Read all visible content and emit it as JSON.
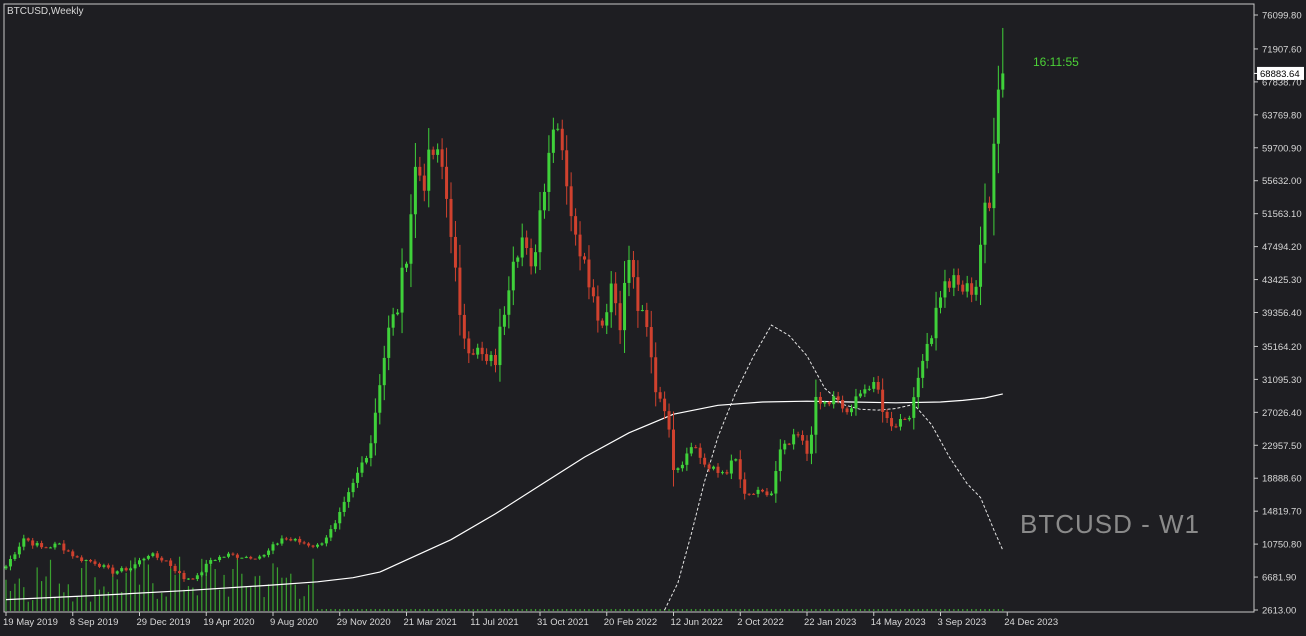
{
  "chart_data": {
    "type": "candlestick",
    "title": "BTCUSD,Weekly",
    "watermark": "BTCUSD - W1",
    "timer": "16:11:55",
    "current_price_label": "68883.64",
    "y_ticks": [
      "76099.80",
      "71907.60",
      "67838.70",
      "63769.80",
      "59700.90",
      "55632.00",
      "51563.10",
      "47494.20",
      "43425.30",
      "39356.40",
      "35164.20",
      "31095.30",
      "27026.40",
      "22957.50",
      "18888.60",
      "14819.70",
      "10750.80",
      "6681.90",
      "2613.00"
    ],
    "ylim": [
      2613.0,
      76099.8
    ],
    "x_ticks": [
      "19 May 2019",
      "8 Sep 2019",
      "29 Dec 2019",
      "19 Apr 2020",
      "9 Aug 2020",
      "29 Nov 2020",
      "21 Mar 2021",
      "11 Jul 2021",
      "31 Oct 2021",
      "20 Feb 2022",
      "12 Jun 2022",
      "2 Oct 2022",
      "22 Jan 2023",
      "14 May 2023",
      "3 Sep 2023",
      "24 Dec 2023"
    ],
    "anchors": [
      {
        "i": 0,
        "c": 8000
      },
      {
        "i": 4,
        "c": 11500
      },
      {
        "i": 8,
        "c": 10300
      },
      {
        "i": 12,
        "c": 10700
      },
      {
        "i": 16,
        "c": 9000
      },
      {
        "i": 20,
        "c": 8500
      },
      {
        "i": 24,
        "c": 7300
      },
      {
        "i": 28,
        "c": 7800
      },
      {
        "i": 32,
        "c": 9500
      },
      {
        "i": 36,
        "c": 8700
      },
      {
        "i": 40,
        "c": 6500
      },
      {
        "i": 43,
        "c": 6700
      },
      {
        "i": 46,
        "c": 8800
      },
      {
        "i": 50,
        "c": 9400
      },
      {
        "i": 54,
        "c": 9200
      },
      {
        "i": 58,
        "c": 9300
      },
      {
        "i": 62,
        "c": 11500
      },
      {
        "i": 66,
        "c": 11000
      },
      {
        "i": 70,
        "c": 10500
      },
      {
        "i": 74,
        "c": 13000
      },
      {
        "i": 78,
        "c": 18000
      },
      {
        "i": 82,
        "c": 23500
      },
      {
        "i": 84,
        "c": 31000
      },
      {
        "i": 86,
        "c": 37000
      },
      {
        "i": 88,
        "c": 40000
      },
      {
        "i": 90,
        "c": 47000
      },
      {
        "i": 92,
        "c": 57000
      },
      {
        "i": 94,
        "c": 56000
      },
      {
        "i": 96,
        "c": 59000
      },
      {
        "i": 98,
        "c": 57000
      },
      {
        "i": 100,
        "c": 50000
      },
      {
        "i": 102,
        "c": 38000
      },
      {
        "i": 104,
        "c": 35500
      },
      {
        "i": 106,
        "c": 34500
      },
      {
        "i": 108,
        "c": 33000
      },
      {
        "i": 110,
        "c": 33500
      },
      {
        "i": 112,
        "c": 40000
      },
      {
        "i": 114,
        "c": 47000
      },
      {
        "i": 116,
        "c": 48500
      },
      {
        "i": 118,
        "c": 44000
      },
      {
        "i": 120,
        "c": 52000
      },
      {
        "i": 122,
        "c": 60000
      },
      {
        "i": 124,
        "c": 64000
      },
      {
        "i": 126,
        "c": 56000
      },
      {
        "i": 128,
        "c": 48000
      },
      {
        "i": 130,
        "c": 47000
      },
      {
        "i": 132,
        "c": 41000
      },
      {
        "i": 134,
        "c": 38000
      },
      {
        "i": 136,
        "c": 43000
      },
      {
        "i": 138,
        "c": 38500
      },
      {
        "i": 140,
        "c": 46000
      },
      {
        "i": 142,
        "c": 40000
      },
      {
        "i": 144,
        "c": 37000
      },
      {
        "i": 146,
        "c": 30000
      },
      {
        "i": 148,
        "c": 28000
      },
      {
        "i": 150,
        "c": 20500
      },
      {
        "i": 152,
        "c": 21000
      },
      {
        "i": 154,
        "c": 23500
      },
      {
        "i": 156,
        "c": 21500
      },
      {
        "i": 158,
        "c": 20000
      },
      {
        "i": 160,
        "c": 19500
      },
      {
        "i": 162,
        "c": 20000
      },
      {
        "i": 164,
        "c": 21000
      },
      {
        "i": 166,
        "c": 16500
      },
      {
        "i": 168,
        "c": 17000
      },
      {
        "i": 170,
        "c": 16800
      },
      {
        "i": 172,
        "c": 17000
      },
      {
        "i": 174,
        "c": 22000
      },
      {
        "i": 176,
        "c": 23000
      },
      {
        "i": 178,
        "c": 24000
      },
      {
        "i": 180,
        "c": 22000
      },
      {
        "i": 182,
        "c": 28000
      },
      {
        "i": 184,
        "c": 28000
      },
      {
        "i": 186,
        "c": 28500
      },
      {
        "i": 188,
        "c": 27500
      },
      {
        "i": 190,
        "c": 26800
      },
      {
        "i": 192,
        "c": 30300
      },
      {
        "i": 194,
        "c": 30000
      },
      {
        "i": 196,
        "c": 29500
      },
      {
        "i": 198,
        "c": 26000
      },
      {
        "i": 200,
        "c": 25800
      },
      {
        "i": 202,
        "c": 26500
      },
      {
        "i": 204,
        "c": 28000
      },
      {
        "i": 206,
        "c": 34500
      },
      {
        "i": 208,
        "c": 37000
      },
      {
        "i": 210,
        "c": 42000
      },
      {
        "i": 212,
        "c": 43000
      },
      {
        "i": 214,
        "c": 42500
      },
      {
        "i": 216,
        "c": 42000
      },
      {
        "i": 218,
        "c": 43000
      },
      {
        "i": 219,
        "c": 48000
      },
      {
        "i": 220,
        "c": 51500
      },
      {
        "i": 221,
        "c": 52000
      },
      {
        "i": 222,
        "c": 62000
      },
      {
        "i": 223,
        "c": 68500
      },
      {
        "i": 224,
        "c": 68883.64
      }
    ],
    "ma_line": [
      {
        "i": 0,
        "v": 3900
      },
      {
        "i": 20,
        "v": 4400
      },
      {
        "i": 40,
        "v": 5000
      },
      {
        "i": 60,
        "v": 5700
      },
      {
        "i": 70,
        "v": 6100
      },
      {
        "i": 78,
        "v": 6600
      },
      {
        "i": 84,
        "v": 7300
      },
      {
        "i": 90,
        "v": 8800
      },
      {
        "i": 100,
        "v": 11300
      },
      {
        "i": 110,
        "v": 14500
      },
      {
        "i": 120,
        "v": 18000
      },
      {
        "i": 130,
        "v": 21500
      },
      {
        "i": 140,
        "v": 24500
      },
      {
        "i": 150,
        "v": 26800
      },
      {
        "i": 160,
        "v": 27900
      },
      {
        "i": 170,
        "v": 28300
      },
      {
        "i": 180,
        "v": 28400
      },
      {
        "i": 190,
        "v": 28300
      },
      {
        "i": 200,
        "v": 28200
      },
      {
        "i": 210,
        "v": 28300
      },
      {
        "i": 215,
        "v": 28500
      },
      {
        "i": 220,
        "v": 28800
      },
      {
        "i": 224,
        "v": 29300
      }
    ],
    "envelope_line": [
      {
        "i": 148,
        "v": 2613
      },
      {
        "i": 151,
        "v": 6000
      },
      {
        "i": 154,
        "v": 12000
      },
      {
        "i": 157,
        "v": 18500
      },
      {
        "i": 160,
        "v": 24000
      },
      {
        "i": 164,
        "v": 29500
      },
      {
        "i": 168,
        "v": 34000
      },
      {
        "i": 172,
        "v": 37800
      },
      {
        "i": 176,
        "v": 36500
      },
      {
        "i": 180,
        "v": 34000
      },
      {
        "i": 184,
        "v": 30000
      },
      {
        "i": 188,
        "v": 28000
      },
      {
        "i": 192,
        "v": 27400
      },
      {
        "i": 196,
        "v": 27300
      },
      {
        "i": 200,
        "v": 27500
      },
      {
        "i": 204,
        "v": 28000
      },
      {
        "i": 208,
        "v": 25500
      },
      {
        "i": 212,
        "v": 21500
      },
      {
        "i": 216,
        "v": 18200
      },
      {
        "i": 219,
        "v": 16500
      },
      {
        "i": 222,
        "v": 12500
      },
      {
        "i": 224,
        "v": 10000
      }
    ]
  }
}
